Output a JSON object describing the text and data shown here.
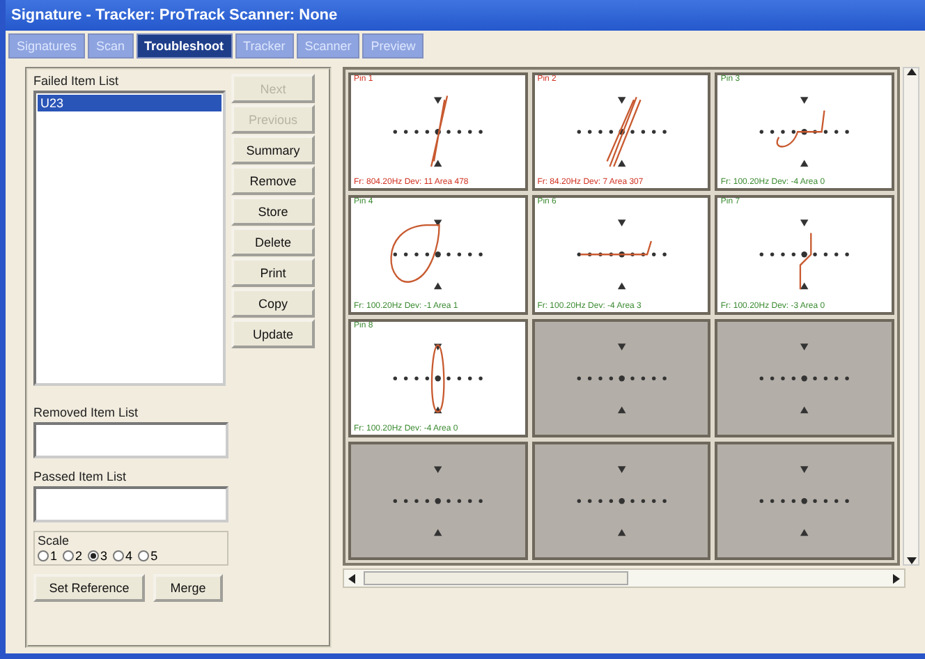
{
  "window": {
    "title": "Signature - Tracker: ProTrack  Scanner: None"
  },
  "tabs": [
    {
      "label": "Signatures",
      "selected": false
    },
    {
      "label": "Scan",
      "selected": false
    },
    {
      "label": "Troubleshoot",
      "selected": true
    },
    {
      "label": "Tracker",
      "selected": false
    },
    {
      "label": "Scanner",
      "selected": false
    },
    {
      "label": "Preview",
      "selected": false
    }
  ],
  "failed_list": {
    "label": "Failed Item List",
    "items": [
      {
        "label": "U23",
        "selected": true
      }
    ]
  },
  "buttons": [
    {
      "label": "Next",
      "disabled": true
    },
    {
      "label": "Previous",
      "disabled": true
    },
    {
      "label": "Summary",
      "disabled": false
    },
    {
      "label": "Remove",
      "disabled": false
    },
    {
      "label": "Store",
      "disabled": false
    },
    {
      "label": "Delete",
      "disabled": false
    },
    {
      "label": "Print",
      "disabled": false
    },
    {
      "label": "Copy",
      "disabled": false
    },
    {
      "label": "Update",
      "disabled": false
    }
  ],
  "removed_list": {
    "label": "Removed Item List"
  },
  "passed_list": {
    "label": "Passed Item List"
  },
  "scale": {
    "label": "Scale",
    "options": [
      {
        "label": "1",
        "selected": false
      },
      {
        "label": "2",
        "selected": false
      },
      {
        "label": "3",
        "selected": true
      },
      {
        "label": "4",
        "selected": false
      },
      {
        "label": "5",
        "selected": false
      }
    ]
  },
  "bottom_buttons": [
    {
      "label": "Set Reference"
    },
    {
      "label": "Merge"
    }
  ],
  "cells": [
    {
      "kind": "trace",
      "label": "Pin 1",
      "readout": "Fr: 804.20Hz   Dev: 11 Area 478",
      "color": "#d03020"
    },
    {
      "kind": "trace",
      "label": "Pin 2",
      "readout": "Fr: 84.20Hz   Dev: 7 Area 307",
      "color": "#d03020"
    },
    {
      "kind": "trace",
      "label": "Pin 3",
      "readout": "Fr: 100.20Hz   Dev: -4 Area 0",
      "color": "#3a8a30"
    },
    {
      "kind": "trace",
      "label": "Pin 4",
      "readout": "Fr: 100.20Hz   Dev: -1 Area 1",
      "color": "#3a8a30"
    },
    {
      "kind": "trace",
      "label": "Pin 6",
      "readout": "Fr: 100.20Hz   Dev: -4 Area 3",
      "color": "#3a8a30"
    },
    {
      "kind": "trace",
      "label": "Pin 7",
      "readout": "Fr: 100.20Hz   Dev: -3 Area 0",
      "color": "#3a8a30"
    },
    {
      "kind": "trace",
      "label": "Pin 8",
      "readout": "Fr: 100.20Hz   Dev: -4 Area 0",
      "color": "#3a8a30"
    },
    {
      "kind": "empty"
    },
    {
      "kind": "empty"
    },
    {
      "kind": "empty"
    },
    {
      "kind": "empty"
    },
    {
      "kind": "empty"
    }
  ]
}
